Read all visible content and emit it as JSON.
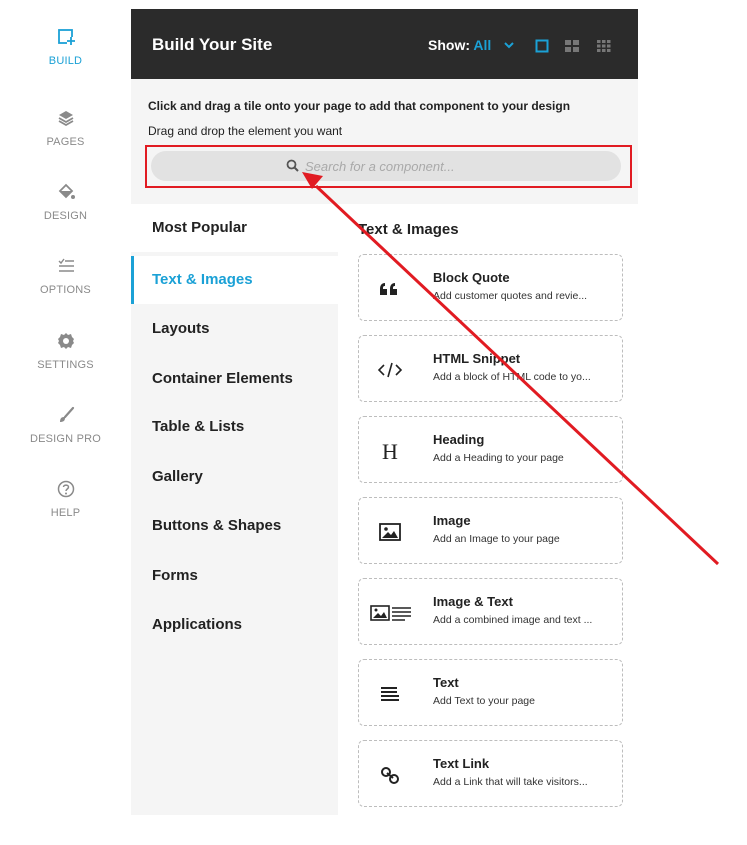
{
  "rail": [
    {
      "label": "BUILD",
      "icon": "build-icon",
      "active": true
    },
    {
      "label": "PAGES",
      "icon": "pages-icon",
      "active": false
    },
    {
      "label": "DESIGN",
      "icon": "paint-bucket-icon",
      "active": false
    },
    {
      "label": "OPTIONS",
      "icon": "options-list-icon",
      "active": false
    },
    {
      "label": "SETTINGS",
      "icon": "gear-icon",
      "active": false
    },
    {
      "label": "DESIGN PRO",
      "icon": "brush-icon",
      "active": false
    },
    {
      "label": "HELP",
      "icon": "help-icon",
      "active": false
    }
  ],
  "header": {
    "title": "Build Your Site",
    "show_label": "Show:",
    "show_value": "All"
  },
  "intro": {
    "line1": "Click and drag a tile onto your page to add that component to your design",
    "line2": "Drag and drop the element you want"
  },
  "search": {
    "placeholder": "Search for a component...",
    "value": ""
  },
  "categories": [
    {
      "label": "Most Popular"
    },
    {
      "label": "Text & Images",
      "active": true
    },
    {
      "label": "Layouts"
    },
    {
      "label": "Container Elements"
    },
    {
      "label": "Table & Lists"
    },
    {
      "label": "Gallery"
    },
    {
      "label": "Buttons & Shapes"
    },
    {
      "label": "Forms"
    },
    {
      "label": "Applications"
    }
  ],
  "section_title": "Text & Images",
  "tiles": [
    {
      "name": "Block Quote",
      "desc": "Add customer quotes and revie...",
      "icon": "quote-icon"
    },
    {
      "name": "HTML Snippet",
      "desc": "Add a block of HTML code to yo...",
      "icon": "code-icon"
    },
    {
      "name": "Heading",
      "desc": "Add a Heading to your page",
      "icon": "heading-icon"
    },
    {
      "name": "Image",
      "desc": "Add an Image to your page",
      "icon": "image-icon"
    },
    {
      "name": "Image & Text",
      "desc": "Add a combined image and text ...",
      "icon": "image-text-icon"
    },
    {
      "name": "Text",
      "desc": "Add Text to your page",
      "icon": "text-lines-icon"
    },
    {
      "name": "Text Link",
      "desc": "Add a Link that will take visitors...",
      "icon": "link-icon"
    }
  ],
  "colors": {
    "accent": "#1ba1d6",
    "header_bg": "#2b2b2b",
    "annotation": "#e11b22"
  }
}
